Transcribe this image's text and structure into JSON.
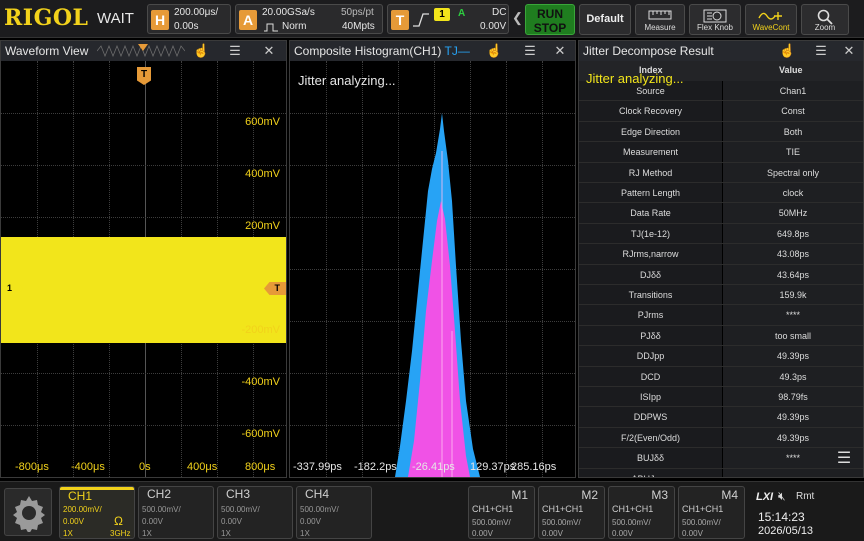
{
  "topbar": {
    "brand": "RIGOL",
    "trigger_state": "WAIT",
    "horizontal": {
      "badge": "H",
      "timebase": "200.00μs/",
      "offset": "0.00s"
    },
    "acquire": {
      "badge": "A",
      "sample_rate": "20.00GSa/s",
      "mode": "Norm",
      "time_res": "50ps/pt",
      "memory": "40Mpts"
    },
    "trigger": {
      "badge": "T",
      "source_num": "1",
      "source_label": "A",
      "coupling": "DC",
      "level": "0.00V"
    },
    "buttons": {
      "run": "RUN",
      "stop": "STOP",
      "default": "Default",
      "measure": "Measure",
      "flex_knob": "Flex Knob",
      "wavecont": "WaveCont",
      "zoom": "Zoom"
    }
  },
  "waveform": {
    "title": "Waveform View",
    "trigger_marker": "T",
    "ch_marker": "1",
    "y_labels": [
      "600mV",
      "400mV",
      "200mV",
      "-200mV",
      "-400mV",
      "-600mV"
    ],
    "x_labels": [
      "-800μs",
      "-400μs",
      "0s",
      "400μs",
      "800μs"
    ],
    "trace_color": "#f2e51b"
  },
  "histogram": {
    "title": "Composite Histogram(CH1)",
    "title_suffix": "TJ—",
    "status": "Jitter analyzing...",
    "x_labels": [
      "-337.99ps",
      "-182.2ps",
      "-26.41ps",
      "129.37ps",
      "285.16ps"
    ],
    "colors": {
      "tj": "#27a3f5",
      "rj": "#f052e6"
    }
  },
  "jitter": {
    "title": "Jitter Decompose Result",
    "status": "Jitter analyzing...",
    "col_index": "Index",
    "col_value": "Value",
    "rows": [
      {
        "index": "Source",
        "value": "Chan1"
      },
      {
        "index": "Clock Recovery",
        "value": "Const"
      },
      {
        "index": "Edge Direction",
        "value": "Both"
      },
      {
        "index": "Measurement",
        "value": "TIE"
      },
      {
        "index": "RJ Method",
        "value": "Spectral only"
      },
      {
        "index": "Pattern Length",
        "value": "clock"
      },
      {
        "index": "Data Rate",
        "value": "50MHz"
      },
      {
        "index": "TJ(1e-12)",
        "value": "649.8ps"
      },
      {
        "index": "RJrms,narrow",
        "value": "43.08ps"
      },
      {
        "index": "DJδδ",
        "value": "43.64ps"
      },
      {
        "index": "Transitions",
        "value": "159.9k"
      },
      {
        "index": "PJrms",
        "value": "****"
      },
      {
        "index": "PJδδ",
        "value": "too small"
      },
      {
        "index": "DDJpp",
        "value": "49.39ps"
      },
      {
        "index": "DCD",
        "value": "49.3ps"
      },
      {
        "index": "ISIpp",
        "value": "98.79fs"
      },
      {
        "index": "DDPWS",
        "value": "49.39ps"
      },
      {
        "index": "F/2(Even/Odd)",
        "value": "49.39ps"
      },
      {
        "index": "BUJδδ",
        "value": "****"
      },
      {
        "index": "ABUJrms",
        "value": ""
      }
    ]
  },
  "channels": [
    {
      "name": "CH1",
      "scale": "200.00mV/",
      "offset": "0.00V",
      "probe": "1X",
      "impedance": "Ω",
      "bandwidth": "3GHz",
      "active": true
    },
    {
      "name": "CH2",
      "scale": "500.00mV/",
      "offset": "0.00V",
      "probe": "1X",
      "impedance": "",
      "bandwidth": "",
      "active": false
    },
    {
      "name": "CH3",
      "scale": "500.00mV/",
      "offset": "0.00V",
      "probe": "1X",
      "impedance": "",
      "bandwidth": "",
      "active": false
    },
    {
      "name": "CH4",
      "scale": "500.00mV/",
      "offset": "0.00V",
      "probe": "1X",
      "impedance": "",
      "bandwidth": "",
      "active": false
    }
  ],
  "math": [
    {
      "name": "M1",
      "expr": "CH1+CH1",
      "scale": "500.00mV/",
      "offset": "0.00V"
    },
    {
      "name": "M2",
      "expr": "CH1+CH1",
      "scale": "500.00mV/",
      "offset": "0.00V"
    },
    {
      "name": "M3",
      "expr": "CH1+CH1",
      "scale": "500.00mV/",
      "offset": "0.00V"
    },
    {
      "name": "M4",
      "expr": "CH1+CH1",
      "scale": "500.00mV/",
      "offset": "0.00V"
    }
  ],
  "status": {
    "lxi": "LXI",
    "remote": "Rmt",
    "time": "15:14:23",
    "date": "2026/05/13",
    "icons": [
      "speaker-muted-icon",
      "gear-icon",
      "menu-icon"
    ]
  }
}
